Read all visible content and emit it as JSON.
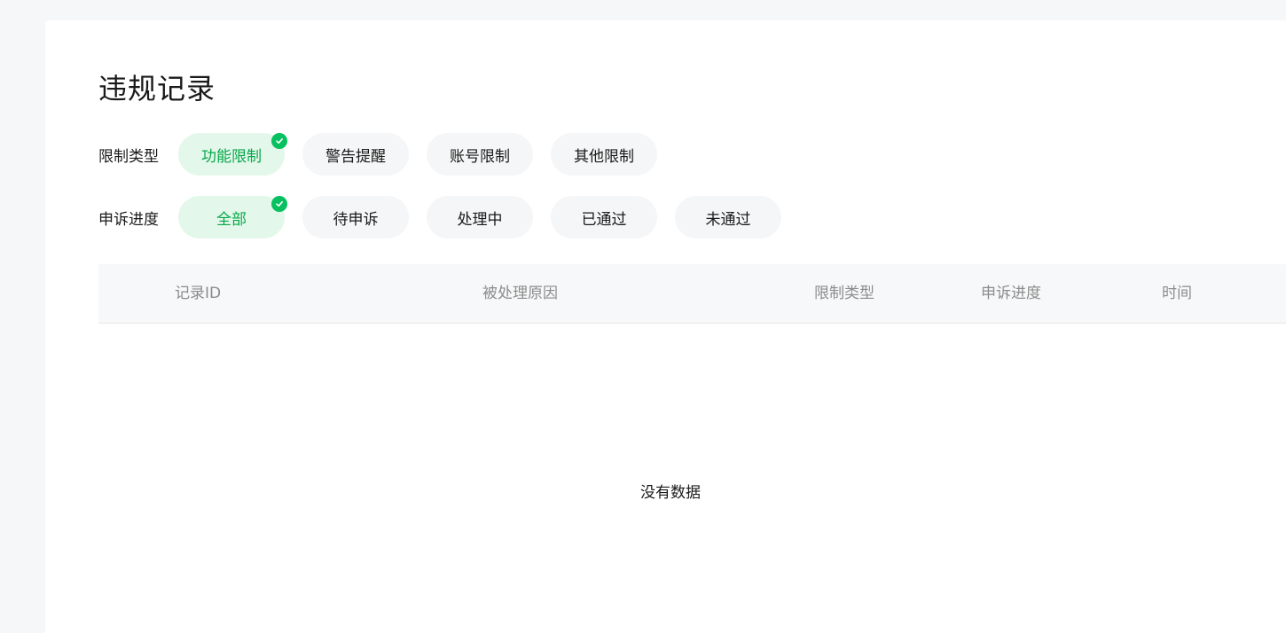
{
  "page": {
    "title": "违规记录",
    "empty_text": "没有数据"
  },
  "filters": {
    "restriction_type": {
      "label": "限制类型",
      "options": [
        "功能限制",
        "警告提醒",
        "账号限制",
        "其他限制"
      ],
      "selected": "功能限制"
    },
    "appeal_progress": {
      "label": "申诉进度",
      "options": [
        "全部",
        "待申诉",
        "处理中",
        "已通过",
        "未通过"
      ],
      "selected": "全部"
    }
  },
  "table": {
    "columns": [
      "记录ID",
      "被处理原因",
      "限制类型",
      "申诉进度",
      "时间"
    ],
    "rows": []
  },
  "colors": {
    "accent": "#07c160",
    "active_chip_bg": "#e3f7ea",
    "active_chip_text": "#07a84a",
    "chip_bg": "#f5f6f7",
    "page_bg": "#f6f7f8",
    "header_text": "#8c8c8c"
  },
  "icons": {
    "selected_indicator": "check-circle-icon"
  }
}
